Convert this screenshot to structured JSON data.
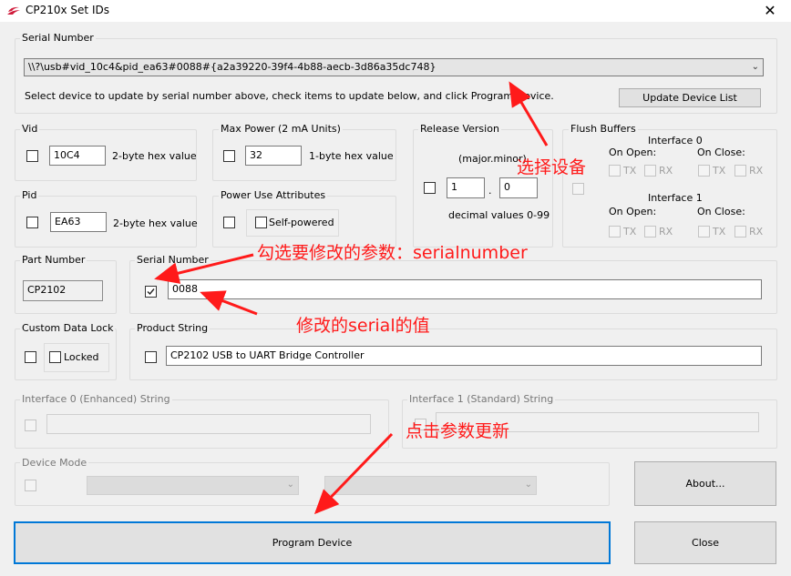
{
  "window": {
    "title": "CP210x Set IDs",
    "close_glyph": "✕"
  },
  "serial_select": {
    "group_label": "Serial Number",
    "selected": "\\\\?\\usb#vid_10c4&pid_ea63#0088#{a2a39220-39f4-4b88-aecb-3d86a35dc748}",
    "hint": "Select device to update by serial number above, check items to update below, and click Program Device.",
    "update_button": "Update Device List"
  },
  "vid": {
    "label": "Vid",
    "value": "10C4",
    "desc": "2-byte hex value"
  },
  "pid": {
    "label": "Pid",
    "value": "EA63",
    "desc": "2-byte hex value"
  },
  "max_power": {
    "label": "Max Power (2 mA Units)",
    "value": "32",
    "desc": "1-byte hex value"
  },
  "power_attr": {
    "label": "Power Use Attributes",
    "option": "Self-powered"
  },
  "release": {
    "label": "Release Version",
    "format": "(major.minor)",
    "major": "1",
    "dot": ".",
    "minor": "0",
    "desc": "decimal values 0-99"
  },
  "flush": {
    "label": "Flush Buffers",
    "if0": "Interface 0",
    "if1": "Interface 1",
    "on_open": "On Open:",
    "on_close": "On Close:",
    "tx": "TX",
    "rx": "RX"
  },
  "part_number": {
    "label": "Part Number",
    "value": "CP2102"
  },
  "serial_number": {
    "label": "Serial Number",
    "value": "0088"
  },
  "custom_lock": {
    "label": "Custom Data Lock",
    "option": "Locked"
  },
  "product_string": {
    "label": "Product String",
    "value": "CP2102 USB to UART Bridge Controller"
  },
  "if0_string": {
    "label": "Interface 0 (Enhanced) String",
    "value": ""
  },
  "if1_string": {
    "label": "Interface 1 (Standard) String",
    "value": ""
  },
  "device_mode": {
    "label": "Device Mode",
    "option1": "",
    "option2": ""
  },
  "buttons": {
    "about": "About...",
    "program": "Program Device",
    "close": "Close"
  },
  "annotations": {
    "select_device": "选择设备",
    "check_param": "勾选要修改的参数：serialnumber",
    "modify_value": "修改的serial的值",
    "click_update": "点击参数更新"
  },
  "colors": {
    "annotation": "#ff1a1a",
    "focus": "#0078d7"
  }
}
